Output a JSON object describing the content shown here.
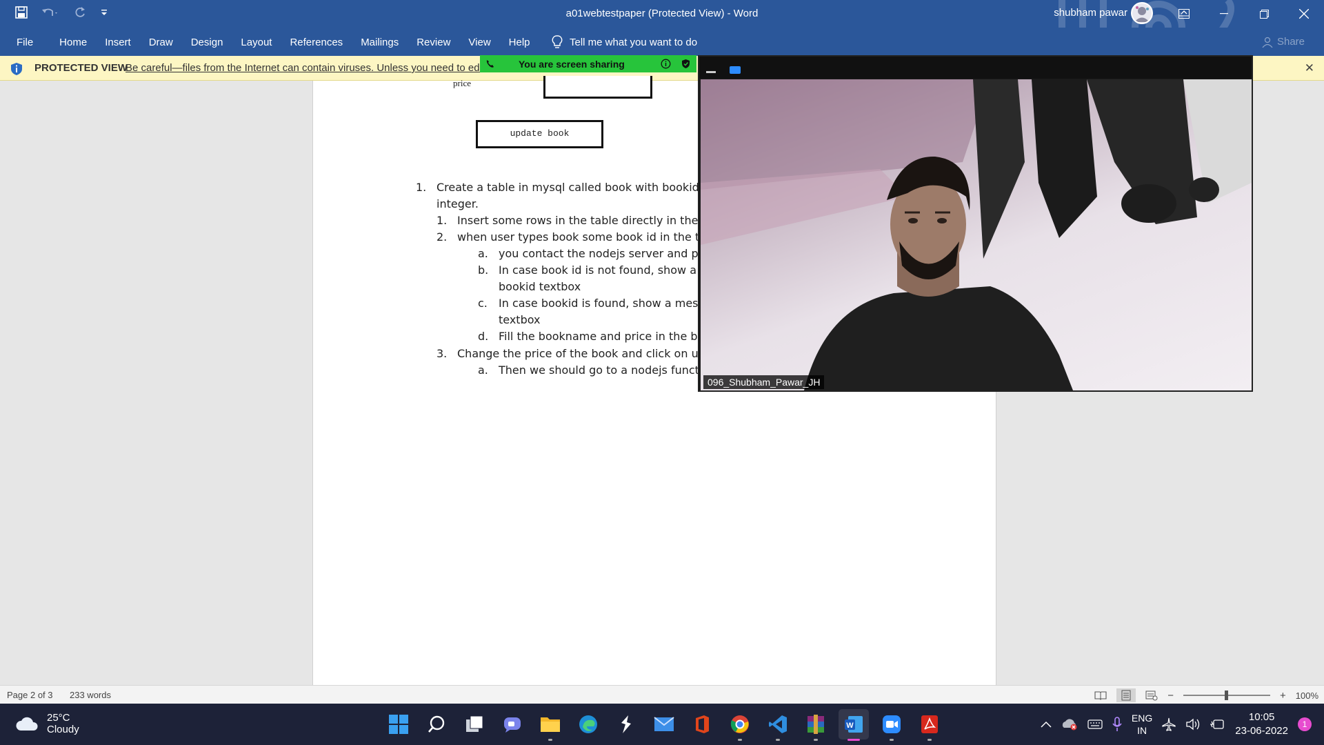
{
  "window": {
    "title": "a01webtestpaper (Protected View)  -  Word",
    "user_name": "shubham pawar",
    "colors": {
      "ribbon": "#2b579a",
      "protected_bar": "#fdf6c3",
      "share_banner": "#27c43b",
      "taskbar": "#1d2238"
    }
  },
  "quick_access": {
    "icons": [
      "save-icon",
      "undo-icon",
      "redo-icon",
      "customize-icon"
    ]
  },
  "ribbon": {
    "tabs": [
      "File",
      "Home",
      "Insert",
      "Draw",
      "Design",
      "Layout",
      "References",
      "Mailings",
      "Review",
      "View",
      "Help"
    ],
    "tell_me": "Tell me what you want to do",
    "share": "Share"
  },
  "protected_view": {
    "title": "PROTECTED VIEW",
    "message": "Be careful—files from the Internet can contain viruses. Unless you need to edit"
  },
  "screen_share": {
    "banner": "You are screen sharing"
  },
  "document": {
    "price_label": "price",
    "update_button": "update book",
    "lines": [
      {
        "marker": "1.",
        "text": "Create a table in mysql called book with bookid inte"
      },
      {
        "marker": "",
        "text": "integer."
      },
      {
        "marker": "1.",
        "text": "Insert some rows in the table directly in the my"
      },
      {
        "marker": "2.",
        "text": "when user types book some book id in the text"
      },
      {
        "marker": "a.",
        "text": "you contact the nodejs server and pick"
      },
      {
        "marker": "b.",
        "text": "In case book id is not found, show a me"
      },
      {
        "marker": "",
        "text": "bookid textbox"
      },
      {
        "marker": "c.",
        "text": "In case bookid is found, show a messag"
      },
      {
        "marker": "",
        "text": "textbox"
      },
      {
        "marker": "d.",
        "text": "Fill the bookname and price in the boo"
      },
      {
        "marker": "3.",
        "text": "Change the price of the book and click on upda"
      },
      {
        "marker": "a.",
        "text": "Then we should go to a nodejs function"
      }
    ]
  },
  "video": {
    "participant": "096_Shubham_Pawar_JH"
  },
  "statusbar": {
    "page": "Page 2 of 3",
    "words": "233 words",
    "zoom": "100%"
  },
  "taskbar": {
    "weather_temp": "25°C",
    "weather_desc": "Cloudy",
    "apps": [
      "windows-start",
      "search",
      "task-view",
      "teams-chat",
      "file-explorer",
      "edge",
      "sublime",
      "mail",
      "office",
      "chrome",
      "vscode",
      "winrar",
      "word",
      "zoom",
      "acrobat"
    ],
    "lang_1": "ENG",
    "lang_2": "IN",
    "time": "10:05",
    "date": "23-06-2022",
    "notifications": "1"
  }
}
